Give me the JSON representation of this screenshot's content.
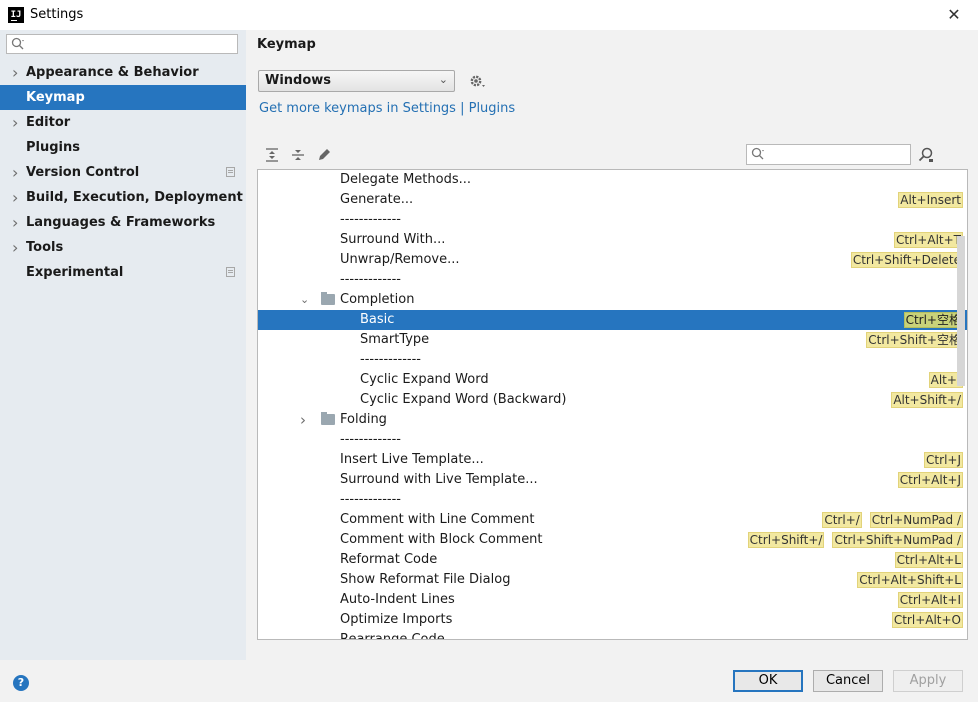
{
  "window": {
    "title": "Settings"
  },
  "sidebar": {
    "search_placeholder": "",
    "items": [
      {
        "label": "Appearance & Behavior",
        "expandable": true
      },
      {
        "label": "Keymap",
        "expandable": false,
        "selected": true
      },
      {
        "label": "Editor",
        "expandable": true
      },
      {
        "label": "Plugins",
        "expandable": false
      },
      {
        "label": "Version Control",
        "expandable": true,
        "project_icon": true
      },
      {
        "label": "Build, Execution, Deployment",
        "expandable": true
      },
      {
        "label": "Languages & Frameworks",
        "expandable": true
      },
      {
        "label": "Tools",
        "expandable": true
      },
      {
        "label": "Experimental",
        "expandable": false,
        "project_icon": true
      }
    ]
  },
  "main": {
    "heading": "Keymap",
    "keymap_selected": "Windows",
    "get_more_link": "Get more keymaps in Settings | Plugins",
    "filter_placeholder": ""
  },
  "tree": {
    "rows": [
      {
        "text": "Delegate Methods...",
        "indent": 1,
        "shortcuts": []
      },
      {
        "text": "Generate...",
        "indent": 1,
        "shortcuts": [
          "Alt+Insert"
        ]
      },
      {
        "text": "-------------",
        "indent": 1,
        "shortcuts": []
      },
      {
        "text": "Surround With...",
        "indent": 1,
        "shortcuts": [
          "Ctrl+Alt+T"
        ]
      },
      {
        "text": "Unwrap/Remove...",
        "indent": 1,
        "shortcuts": [
          "Ctrl+Shift+Delete"
        ]
      },
      {
        "text": "-------------",
        "indent": 1,
        "shortcuts": []
      },
      {
        "text": "Completion",
        "indent": 1,
        "folder": true,
        "expanded": true,
        "shortcuts": []
      },
      {
        "text": "Basic",
        "indent": 2,
        "selected": true,
        "shortcuts": [
          "Ctrl+空格"
        ]
      },
      {
        "text": "SmartType",
        "indent": 2,
        "shortcuts": [
          "Ctrl+Shift+空格"
        ]
      },
      {
        "text": "-------------",
        "indent": 2,
        "shortcuts": []
      },
      {
        "text": "Cyclic Expand Word",
        "indent": 2,
        "shortcuts": [
          "Alt+/"
        ]
      },
      {
        "text": "Cyclic Expand Word (Backward)",
        "indent": 2,
        "shortcuts": [
          "Alt+Shift+/"
        ]
      },
      {
        "text": "Folding",
        "indent": 1,
        "folder": true,
        "expanded": false,
        "shortcuts": []
      },
      {
        "text": "-------------",
        "indent": 1,
        "shortcuts": []
      },
      {
        "text": "Insert Live Template...",
        "indent": 1,
        "shortcuts": [
          "Ctrl+J"
        ]
      },
      {
        "text": "Surround with Live Template...",
        "indent": 1,
        "shortcuts": [
          "Ctrl+Alt+J"
        ]
      },
      {
        "text": "-------------",
        "indent": 1,
        "shortcuts": []
      },
      {
        "text": "Comment with Line Comment",
        "indent": 1,
        "shortcuts": [
          "Ctrl+/",
          "Ctrl+NumPad /"
        ]
      },
      {
        "text": "Comment with Block Comment",
        "indent": 1,
        "shortcuts": [
          "Ctrl+Shift+/",
          "Ctrl+Shift+NumPad /"
        ]
      },
      {
        "text": "Reformat Code",
        "indent": 1,
        "shortcuts": [
          "Ctrl+Alt+L"
        ]
      },
      {
        "text": "Show Reformat File Dialog",
        "indent": 1,
        "shortcuts": [
          "Ctrl+Alt+Shift+L"
        ]
      },
      {
        "text": "Auto-Indent Lines",
        "indent": 1,
        "shortcuts": [
          "Ctrl+Alt+I"
        ]
      },
      {
        "text": "Optimize Imports",
        "indent": 1,
        "shortcuts": [
          "Ctrl+Alt+O"
        ]
      },
      {
        "text": "Rearrange Code",
        "indent": 1,
        "shortcuts": []
      }
    ]
  },
  "footer": {
    "help": "?",
    "ok": "OK",
    "cancel": "Cancel",
    "apply": "Apply"
  },
  "colors": {
    "selection": "#2675bf",
    "link": "#2470b3",
    "shortcut_bg": "#f2e8a0",
    "sidebar_bg": "#e6ebf0"
  },
  "icons": {
    "app": "intellij-icon",
    "close": "close-icon",
    "search": "search-icon",
    "gear": "gear-icon",
    "expand_all": "expand-all-icon",
    "collapse_all": "collapse-all-icon",
    "edit": "pencil-icon",
    "find_shortcut": "find-shortcut-icon"
  }
}
